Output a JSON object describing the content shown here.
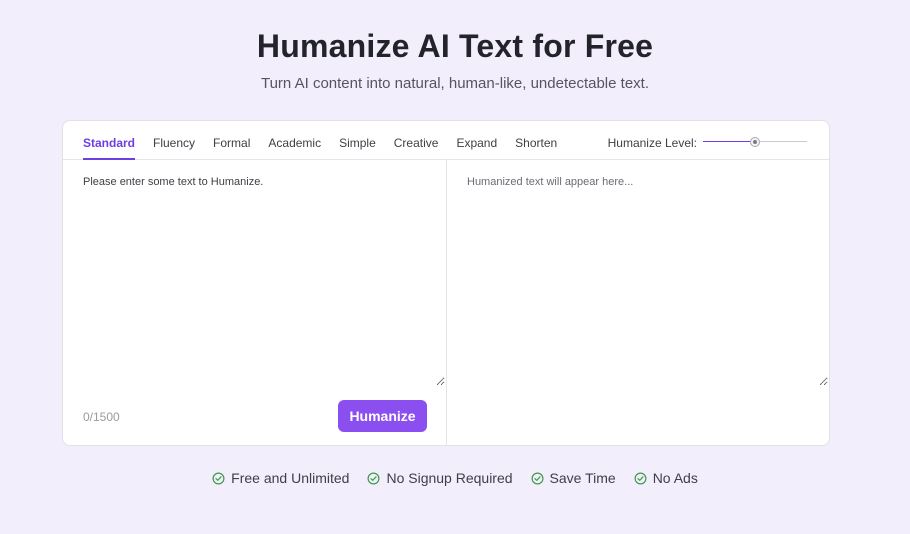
{
  "hero": {
    "title": "Humanize AI Text for Free",
    "subtitle": "Turn AI content into natural, human-like, undetectable text."
  },
  "tabs": [
    {
      "label": "Standard",
      "active": true
    },
    {
      "label": "Fluency",
      "active": false
    },
    {
      "label": "Formal",
      "active": false
    },
    {
      "label": "Academic",
      "active": false
    },
    {
      "label": "Simple",
      "active": false
    },
    {
      "label": "Creative",
      "active": false
    },
    {
      "label": "Expand",
      "active": false
    },
    {
      "label": "Shorten",
      "active": false
    }
  ],
  "level": {
    "label": "Humanize Level:",
    "value_fraction": 0.5
  },
  "input": {
    "placeholder": "Please enter some text to Humanize.",
    "value": "",
    "char_count": "0/1500"
  },
  "output": {
    "placeholder": "Humanized text will appear here..."
  },
  "action": {
    "button_label": "Humanize"
  },
  "features": [
    {
      "label": "Free and Unlimited",
      "icon": "check-circle-icon"
    },
    {
      "label": "No Signup Required",
      "icon": "check-circle-icon"
    },
    {
      "label": "Save Time",
      "icon": "check-circle-icon"
    },
    {
      "label": "No Ads",
      "icon": "check-circle-icon"
    }
  ],
  "colors": {
    "accent": "#6d3fe0",
    "button": "#8b4ff0",
    "background": "#f2eefb",
    "check": "#3f9a4a"
  }
}
